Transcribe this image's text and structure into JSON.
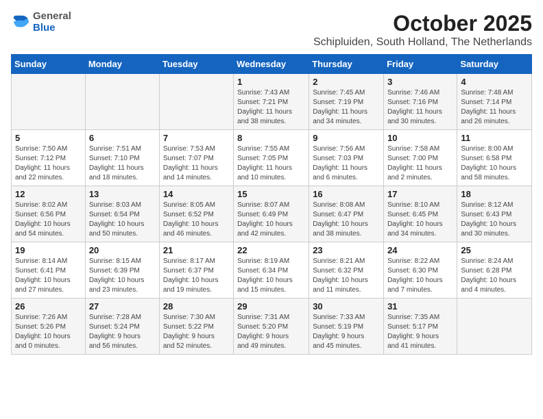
{
  "header": {
    "logo": {
      "general": "General",
      "blue": "Blue"
    },
    "title": "October 2025",
    "subtitle": "Schipluiden, South Holland, The Netherlands"
  },
  "weekdays": [
    "Sunday",
    "Monday",
    "Tuesday",
    "Wednesday",
    "Thursday",
    "Friday",
    "Saturday"
  ],
  "weeks": [
    [
      {
        "day": "",
        "info": ""
      },
      {
        "day": "",
        "info": ""
      },
      {
        "day": "",
        "info": ""
      },
      {
        "day": "1",
        "info": "Sunrise: 7:43 AM\nSunset: 7:21 PM\nDaylight: 11 hours\nand 38 minutes."
      },
      {
        "day": "2",
        "info": "Sunrise: 7:45 AM\nSunset: 7:19 PM\nDaylight: 11 hours\nand 34 minutes."
      },
      {
        "day": "3",
        "info": "Sunrise: 7:46 AM\nSunset: 7:16 PM\nDaylight: 11 hours\nand 30 minutes."
      },
      {
        "day": "4",
        "info": "Sunrise: 7:48 AM\nSunset: 7:14 PM\nDaylight: 11 hours\nand 26 minutes."
      }
    ],
    [
      {
        "day": "5",
        "info": "Sunrise: 7:50 AM\nSunset: 7:12 PM\nDaylight: 11 hours\nand 22 minutes."
      },
      {
        "day": "6",
        "info": "Sunrise: 7:51 AM\nSunset: 7:10 PM\nDaylight: 11 hours\nand 18 minutes."
      },
      {
        "day": "7",
        "info": "Sunrise: 7:53 AM\nSunset: 7:07 PM\nDaylight: 11 hours\nand 14 minutes."
      },
      {
        "day": "8",
        "info": "Sunrise: 7:55 AM\nSunset: 7:05 PM\nDaylight: 11 hours\nand 10 minutes."
      },
      {
        "day": "9",
        "info": "Sunrise: 7:56 AM\nSunset: 7:03 PM\nDaylight: 11 hours\nand 6 minutes."
      },
      {
        "day": "10",
        "info": "Sunrise: 7:58 AM\nSunset: 7:00 PM\nDaylight: 11 hours\nand 2 minutes."
      },
      {
        "day": "11",
        "info": "Sunrise: 8:00 AM\nSunset: 6:58 PM\nDaylight: 10 hours\nand 58 minutes."
      }
    ],
    [
      {
        "day": "12",
        "info": "Sunrise: 8:02 AM\nSunset: 6:56 PM\nDaylight: 10 hours\nand 54 minutes."
      },
      {
        "day": "13",
        "info": "Sunrise: 8:03 AM\nSunset: 6:54 PM\nDaylight: 10 hours\nand 50 minutes."
      },
      {
        "day": "14",
        "info": "Sunrise: 8:05 AM\nSunset: 6:52 PM\nDaylight: 10 hours\nand 46 minutes."
      },
      {
        "day": "15",
        "info": "Sunrise: 8:07 AM\nSunset: 6:49 PM\nDaylight: 10 hours\nand 42 minutes."
      },
      {
        "day": "16",
        "info": "Sunrise: 8:08 AM\nSunset: 6:47 PM\nDaylight: 10 hours\nand 38 minutes."
      },
      {
        "day": "17",
        "info": "Sunrise: 8:10 AM\nSunset: 6:45 PM\nDaylight: 10 hours\nand 34 minutes."
      },
      {
        "day": "18",
        "info": "Sunrise: 8:12 AM\nSunset: 6:43 PM\nDaylight: 10 hours\nand 30 minutes."
      }
    ],
    [
      {
        "day": "19",
        "info": "Sunrise: 8:14 AM\nSunset: 6:41 PM\nDaylight: 10 hours\nand 27 minutes."
      },
      {
        "day": "20",
        "info": "Sunrise: 8:15 AM\nSunset: 6:39 PM\nDaylight: 10 hours\nand 23 minutes."
      },
      {
        "day": "21",
        "info": "Sunrise: 8:17 AM\nSunset: 6:37 PM\nDaylight: 10 hours\nand 19 minutes."
      },
      {
        "day": "22",
        "info": "Sunrise: 8:19 AM\nSunset: 6:34 PM\nDaylight: 10 hours\nand 15 minutes."
      },
      {
        "day": "23",
        "info": "Sunrise: 8:21 AM\nSunset: 6:32 PM\nDaylight: 10 hours\nand 11 minutes."
      },
      {
        "day": "24",
        "info": "Sunrise: 8:22 AM\nSunset: 6:30 PM\nDaylight: 10 hours\nand 7 minutes."
      },
      {
        "day": "25",
        "info": "Sunrise: 8:24 AM\nSunset: 6:28 PM\nDaylight: 10 hours\nand 4 minutes."
      }
    ],
    [
      {
        "day": "26",
        "info": "Sunrise: 7:26 AM\nSunset: 5:26 PM\nDaylight: 10 hours\nand 0 minutes."
      },
      {
        "day": "27",
        "info": "Sunrise: 7:28 AM\nSunset: 5:24 PM\nDaylight: 9 hours\nand 56 minutes."
      },
      {
        "day": "28",
        "info": "Sunrise: 7:30 AM\nSunset: 5:22 PM\nDaylight: 9 hours\nand 52 minutes."
      },
      {
        "day": "29",
        "info": "Sunrise: 7:31 AM\nSunset: 5:20 PM\nDaylight: 9 hours\nand 49 minutes."
      },
      {
        "day": "30",
        "info": "Sunrise: 7:33 AM\nSunset: 5:19 PM\nDaylight: 9 hours\nand 45 minutes."
      },
      {
        "day": "31",
        "info": "Sunrise: 7:35 AM\nSunset: 5:17 PM\nDaylight: 9 hours\nand 41 minutes."
      },
      {
        "day": "",
        "info": ""
      }
    ]
  ]
}
